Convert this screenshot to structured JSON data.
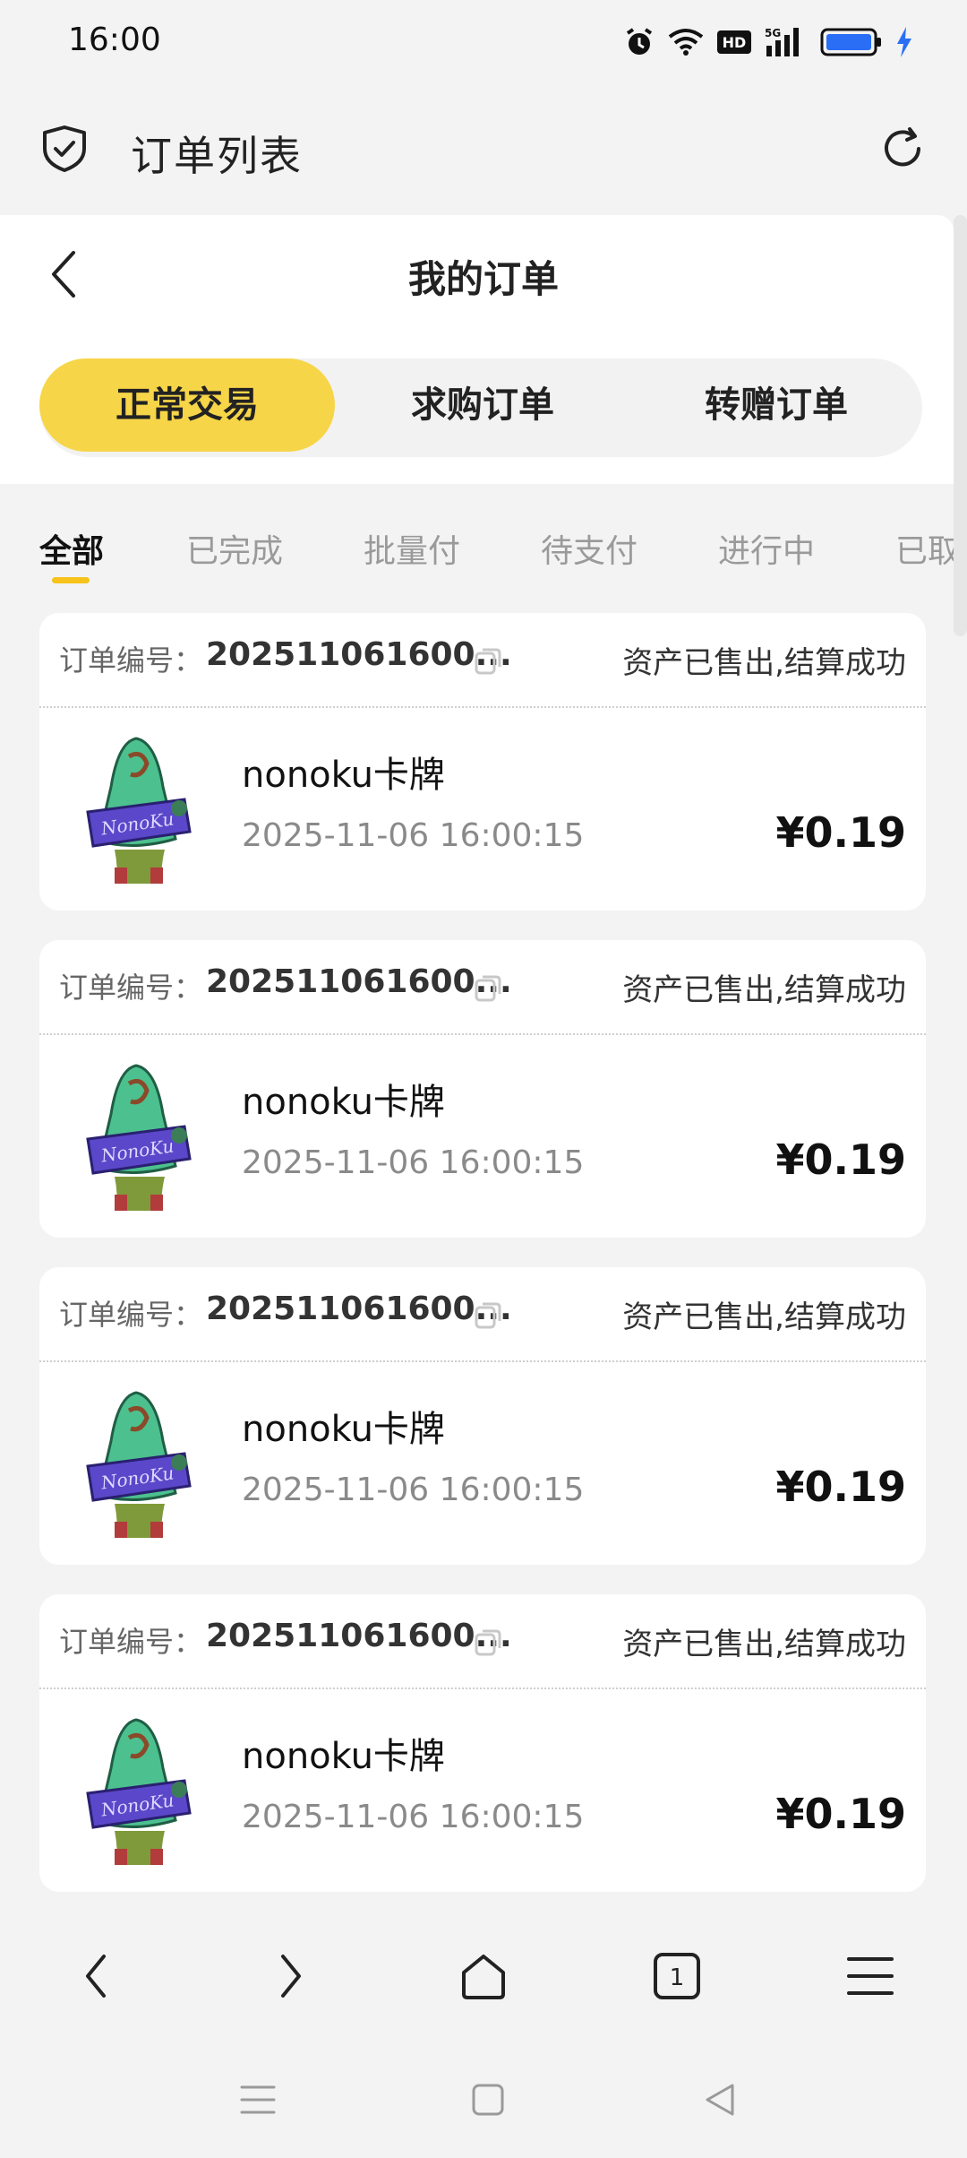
{
  "status_bar": {
    "time": "16:00",
    "icons": [
      "alarm-icon",
      "wifi-icon",
      "hd-icon",
      "5g-signal-icon",
      "battery-icon",
      "charging-icon"
    ],
    "hd_text": "HD",
    "network_text": "5G"
  },
  "browser": {
    "title": "订单列表",
    "tab_count": "1"
  },
  "page": {
    "title": "我的订单",
    "segments": [
      "正常交易",
      "求购订单",
      "转赠订单"
    ],
    "active_segment": 0,
    "filters": [
      "全部",
      "已完成",
      "批量付",
      "待支付",
      "进行中",
      "已取消"
    ],
    "active_filter": 0
  },
  "orders": [
    {
      "label": "订单编号：",
      "number": "202511061600...",
      "status": "资产已售出,结算成功",
      "name": "nonoku卡牌",
      "time": "2025-11-06 16:00:15",
      "price": "¥0.19"
    },
    {
      "label": "订单编号：",
      "number": "202511061600...",
      "status": "资产已售出,结算成功",
      "name": "nonoku卡牌",
      "time": "2025-11-06 16:00:15",
      "price": "¥0.19"
    },
    {
      "label": "订单编号：",
      "number": "202511061600...",
      "status": "资产已售出,结算成功",
      "name": "nonoku卡牌",
      "time": "2025-11-06 16:00:15",
      "price": "¥0.19"
    },
    {
      "label": "订单编号：",
      "number": "202511061600...",
      "status": "资产已售出,结算成功",
      "name": "nonoku卡牌",
      "time": "2025-11-06 16:00:15",
      "price": "¥0.19"
    }
  ],
  "thumbnail_text": "NonoKu",
  "colors": {
    "accent": "#f7d548",
    "underline": "#f7c31a",
    "background": "#f3f3f3",
    "battery": "#2a6ef5"
  }
}
